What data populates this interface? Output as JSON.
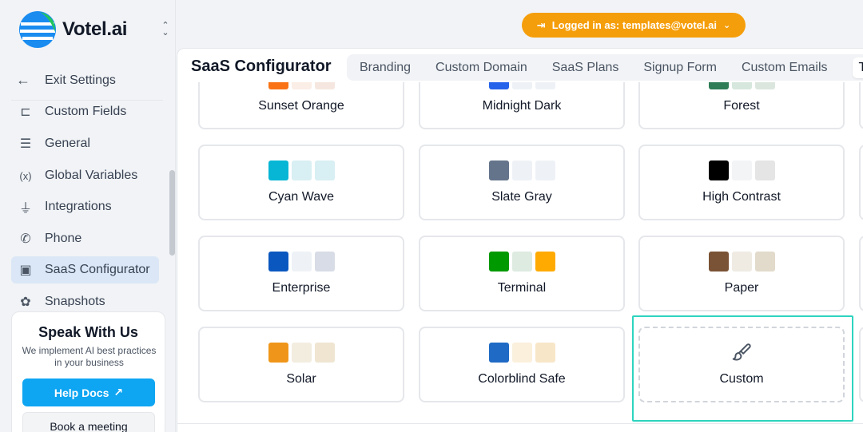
{
  "brand": {
    "name": "Votel.ai"
  },
  "sidebar": {
    "exit_label": "Exit Settings",
    "items": [
      {
        "label": "Custom Fields",
        "icon": "custom-fields-icon",
        "glyph": "⊏"
      },
      {
        "label": "General",
        "icon": "sliders-icon",
        "glyph": "☰"
      },
      {
        "label": "Global Variables",
        "icon": "variable-icon",
        "glyph": "(x)"
      },
      {
        "label": "Integrations",
        "icon": "plug-icon",
        "glyph": "⏚"
      },
      {
        "label": "Phone",
        "icon": "phone-icon",
        "glyph": "✆"
      },
      {
        "label": "SaaS Configurator",
        "icon": "layout-icon",
        "glyph": "▣",
        "active": true
      },
      {
        "label": "Snapshots",
        "icon": "snapshot-icon",
        "glyph": "✿"
      }
    ],
    "speak": {
      "title": "Speak With Us",
      "body": "We implement AI best practices in your business",
      "help_label": "Help Docs",
      "book_label": "Book a meeting"
    }
  },
  "header": {
    "login_text": "Logged in as: templates@votel.ai"
  },
  "panel": {
    "title": "SaaS Configurator",
    "tabs": [
      "Branding",
      "Custom Domain",
      "SaaS Plans",
      "Signup Form",
      "Custom Emails",
      "T"
    ]
  },
  "themes": [
    {
      "name": "Sunset Orange",
      "colors": [
        "#f97316",
        "#fbeee6",
        "#f5e7df"
      ]
    },
    {
      "name": "Midnight Dark",
      "colors": [
        "#2563eb",
        "#eef2f7",
        "#eef2f7"
      ]
    },
    {
      "name": "Forest",
      "colors": [
        "#2e7d57",
        "#d6e7dd",
        "#dbe7de"
      ]
    },
    {
      "name": "Cyan Wave",
      "colors": [
        "#06b6d4",
        "#d8eff3",
        "#d8eff3"
      ]
    },
    {
      "name": "Slate Gray",
      "colors": [
        "#64748b",
        "#eef2f7",
        "#eef2f7"
      ]
    },
    {
      "name": "High Contrast",
      "colors": [
        "#000000",
        "#f3f4f6",
        "#e5e5e5"
      ]
    },
    {
      "name": "Enterprise",
      "colors": [
        "#0b57c0",
        "#eef2f7",
        "#d7dce6"
      ]
    },
    {
      "name": "Terminal",
      "colors": [
        "#009900",
        "#ddebe0",
        "#ffaa00"
      ]
    },
    {
      "name": "Paper",
      "colors": [
        "#7a5235",
        "#efebe3",
        "#e2dacb"
      ]
    },
    {
      "name": "Solar",
      "colors": [
        "#ef961a",
        "#f3ede0",
        "#efe5d1"
      ]
    },
    {
      "name": "Colorblind Safe",
      "colors": [
        "#1f6ac4",
        "#fbf0dc",
        "#f8e6c8"
      ]
    }
  ],
  "custom_card": {
    "name": "Custom",
    "icon": "paintbrush-icon"
  },
  "colors": {
    "accent": "#0ea5f2",
    "login_pill": "#f59e0b",
    "focus": "#2dd4bf",
    "active_nav": "#dbe7f6"
  }
}
